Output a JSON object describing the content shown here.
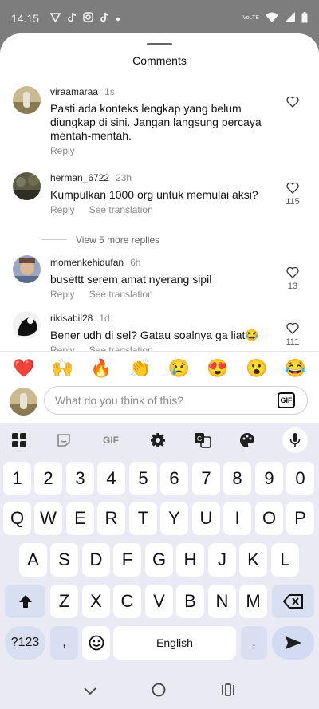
{
  "status_bar": {
    "time": "14.15",
    "notification_icons": [
      "vpn-icon",
      "tiktok-icon",
      "instagram-icon",
      "tiktok-icon",
      "dot-icon"
    ],
    "volte_label": "VoLTE",
    "right_icons": [
      "wifi-icon",
      "signal-icon",
      "battery-icon"
    ]
  },
  "sheet": {
    "title": "Comments"
  },
  "comments": [
    {
      "username": "viraamaraa",
      "time": "1s",
      "text": "Pasti ada konteks lengkap yang belum diungkap di sini. Jangan langsung percaya mentah-mentah.",
      "reply_label": "Reply",
      "translate_label": "",
      "likes": ""
    },
    {
      "username": "herman_6722",
      "time": "23h",
      "text": "Kumpulkan 1000 org untuk memulai aksi?",
      "reply_label": "Reply",
      "translate_label": "See translation",
      "likes": "115"
    },
    {
      "username": "momenkehidufan",
      "time": "6h",
      "text": "busettt serem amat nyerang sipil",
      "reply_label": "Reply",
      "translate_label": "See translation",
      "likes": "13"
    },
    {
      "username": "rikisabil28",
      "time": "1d",
      "text": "Bener udh di sel? Gatau soalnya ga liat😂",
      "reply_label": "Reply",
      "translate_label": "See translation",
      "likes": "111"
    }
  ],
  "more_replies": "View 5 more replies",
  "emoji_bar": [
    "❤️",
    "🙌",
    "🔥",
    "👏",
    "😢",
    "😍",
    "😮",
    "😂"
  ],
  "compose": {
    "placeholder": "What do you think of this?",
    "gif_label": "GIF"
  },
  "keyboard": {
    "toolbar_icons": [
      "apps-grid-icon",
      "sticker-icon",
      "gif-icon",
      "settings-gear-icon",
      "translate-icon",
      "palette-icon",
      "microphone-icon"
    ],
    "toolbar_gif_label": "GIF",
    "row1": [
      "1",
      "2",
      "3",
      "4",
      "5",
      "6",
      "7",
      "8",
      "9",
      "0"
    ],
    "row2": [
      "Q",
      "W",
      "E",
      "R",
      "T",
      "Y",
      "U",
      "I",
      "O",
      "P"
    ],
    "row3": [
      "A",
      "S",
      "D",
      "F",
      "G",
      "H",
      "J",
      "K",
      "L"
    ],
    "row4": [
      "Z",
      "X",
      "C",
      "V",
      "B",
      "N",
      "M"
    ],
    "symbols_label": "?123",
    "comma_label": ",",
    "space_label": "English",
    "period_label": "."
  },
  "nav_icons": [
    "back-chevron-icon",
    "home-circle-icon",
    "recents-icon"
  ],
  "colors": {
    "dim_background": "#7d7d7d",
    "keyboard_bg": "#e9eaf4",
    "modifier_key": "#d8dff0",
    "heart": "#e8112d"
  }
}
